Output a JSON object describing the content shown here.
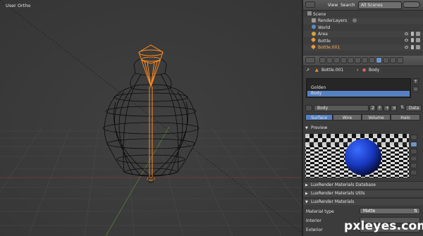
{
  "viewport": {
    "label": "User Ortho"
  },
  "outliner": {
    "header": {
      "view": "View",
      "search": "Search",
      "scope": "All Scenes"
    },
    "rows": [
      {
        "label": "Scene"
      },
      {
        "label": "RenderLayers"
      },
      {
        "label": "World"
      },
      {
        "label": "Area"
      },
      {
        "label": "Bottle"
      },
      {
        "label": "Bottle.001"
      }
    ]
  },
  "properties": {
    "breadcrumb": {
      "object": "Bottle.001",
      "material": "Body"
    },
    "materials": [
      "Golden",
      "Body"
    ],
    "active_material": "Body",
    "material_field": {
      "name": "Body",
      "users": "2",
      "fake": "F"
    },
    "link_select": "Data",
    "preview_tabs": [
      "Surface",
      "Wire",
      "Volume",
      "Halo"
    ],
    "sections": {
      "preview": "Preview",
      "db": "LuxRender Materials Database",
      "utils": "LuxRender Materials Utils",
      "materials": "LuxRender Materials"
    },
    "material_type_label": "Material type",
    "material_type_value": "Matte",
    "interior_label": "Interior",
    "exterior_label": "Exterior"
  },
  "watermark": "pxleyes.com",
  "colors": {
    "accent": "#5680c2",
    "selection_wire": "#ff8a1f",
    "wire": "#000000"
  }
}
